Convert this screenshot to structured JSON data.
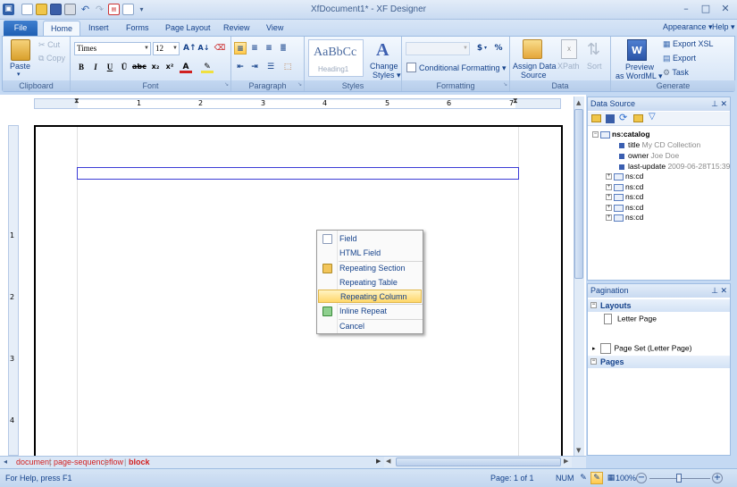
{
  "window": {
    "title": "XfDocument1* - XF Designer"
  },
  "quick_access": [
    "app-icon",
    "new-icon",
    "open-icon",
    "save-icon",
    "print-icon",
    "undo-icon",
    "redo-icon",
    "pdf-icon",
    "preview-icon",
    "customize-icon"
  ],
  "tabs": {
    "file": "File",
    "home": "Home",
    "insert": "Insert",
    "forms": "Forms",
    "page_layout": "Page Layout",
    "review": "Review",
    "view": "View"
  },
  "top_right": {
    "appearance": "Appearance",
    "help": "Help"
  },
  "ribbon": {
    "clipboard": {
      "label": "Clipboard",
      "paste": "Paste",
      "cut": "Cut",
      "copy": "Copy"
    },
    "font": {
      "label": "Font",
      "family": "Times",
      "size": "12"
    },
    "paragraph": {
      "label": "Paragraph"
    },
    "styles": {
      "label": "Styles",
      "sample": "AaBbCc",
      "sample_name": "Heading1",
      "change": "Change",
      "change2": "Styles"
    },
    "formatting": {
      "label": "Formatting",
      "currency": "$",
      "percent": "%",
      "conditional": "Conditional Formatting"
    },
    "data": {
      "label": "Data",
      "assign1": "Assign Data",
      "assign2": "Source",
      "xpath": "XPath",
      "sort": "Sort"
    },
    "generate": {
      "label": "Generate",
      "preview1": "Preview",
      "preview2": "as WordML",
      "export_xsl": "Export XSL",
      "export": "Export",
      "task": "Task"
    }
  },
  "ruler_numbers": [
    "1",
    "2",
    "3",
    "4",
    "5",
    "6",
    "7"
  ],
  "vruler_numbers": [
    "1",
    "2",
    "3",
    "4"
  ],
  "context_menu": {
    "field": "Field",
    "html_field": "HTML Field",
    "repeating_section": "Repeating Section",
    "repeating_table": "Repeating Table",
    "repeating_column": "Repeating Column",
    "inline_repeat": "Inline Repeat",
    "cancel": "Cancel"
  },
  "breadcrumb": [
    "document",
    "page-sequence",
    "flow",
    "block"
  ],
  "data_source": {
    "title": "Data Source",
    "root": "ns:catalog",
    "fields": [
      {
        "name": "title",
        "value": "My CD Collection"
      },
      {
        "name": "owner",
        "value": "Joe Doe"
      },
      {
        "name": "last-update",
        "value": "2009-06-28T15:39:"
      }
    ],
    "items": [
      "ns:cd",
      "ns:cd",
      "ns:cd",
      "ns:cd",
      "ns:cd"
    ]
  },
  "pagination": {
    "title": "Pagination",
    "layouts": "Layouts",
    "layout_item": "Letter Page",
    "pages": "Pages",
    "pages_item": "Page Set (Letter Page)"
  },
  "status": {
    "help": "For Help, press F1",
    "page": "Page: 1 of 1",
    "num": "NUM",
    "zoom": "100%"
  }
}
